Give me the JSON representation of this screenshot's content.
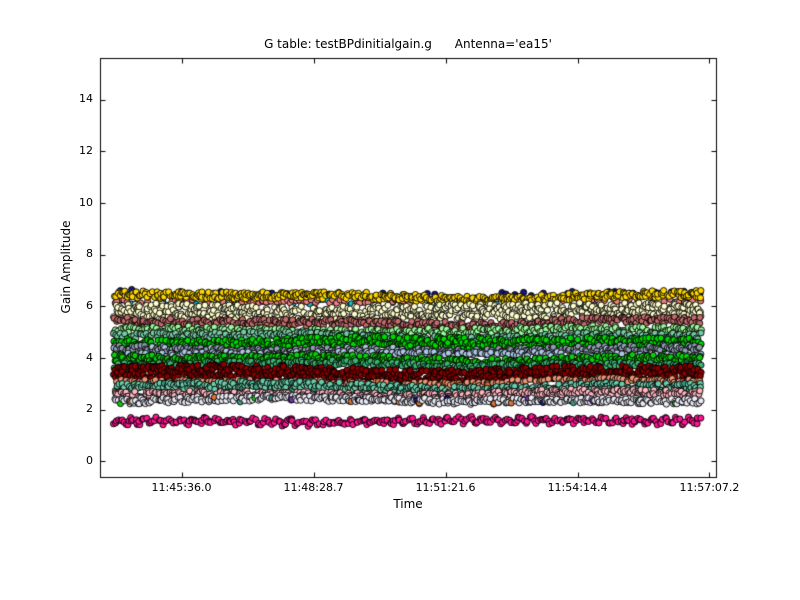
{
  "figure": {
    "background": "#FFFFFF",
    "frame_color": "#000000"
  },
  "chart_data": {
    "type": "scatter",
    "title": "G table: testBPdinitialgain.g      Antenna='ea15'",
    "xlabel": "Time",
    "ylabel": "Gain Amplitude",
    "xticklabels": [
      "11:45:36.0",
      "11:48:28.7",
      "11:51:21.6",
      "11:54:14.4",
      "11:57:07.2"
    ],
    "xtick_positions": [
      0.1315,
      0.3458,
      0.5601,
      0.7744,
      0.9886
    ],
    "yticklabels": [
      "0",
      "2",
      "4",
      "6",
      "8",
      "10",
      "12",
      "14"
    ],
    "yticks": [
      0,
      2,
      4,
      6,
      8,
      10,
      12,
      14
    ],
    "ylim": [
      -0.62,
      15.6
    ],
    "grid": false,
    "legend": "none",
    "marker": {
      "radius": 3.1,
      "edge_color": "#000000",
      "edge_width": 0.9
    },
    "data_x_span": [
      0.0227,
      0.9756
    ],
    "series": [
      {
        "name": "navy-speckles",
        "color": "#161685",
        "center": 6.5,
        "spread": 0.1,
        "density": 0.13,
        "wave": 0.05
      },
      {
        "name": "cyan-speckles",
        "color": "#00CBDB",
        "center": 6.17,
        "spread": 0.13,
        "density": 0.13,
        "wave": 0.05
      },
      {
        "name": "lightcoral-row",
        "color": "#F08080",
        "center": 6.23,
        "spread": 0.08,
        "density": 0.4,
        "wave": 0.05
      },
      {
        "name": "gold-band",
        "color": "#FFD700",
        "center": 6.4,
        "spread": 0.14,
        "density": 1.7,
        "wave": 0.07
      },
      {
        "name": "cream-band",
        "color": "#FFFFCC",
        "center": 5.78,
        "spread": 0.32,
        "density": 2.6,
        "wave": 0.06
      },
      {
        "name": "rosybrown-band",
        "color": "#C36B6B",
        "center": 5.38,
        "spread": 0.14,
        "density": 1.3,
        "wave": 0.06
      },
      {
        "name": "palegreen-band",
        "color": "#98FB98",
        "center": 5.08,
        "spread": 0.13,
        "density": 1.2,
        "wave": 0.05
      },
      {
        "name": "seafoam-band",
        "color": "#76C9A5",
        "center": 4.85,
        "spread": 0.12,
        "density": 1.0,
        "wave": 0.05
      },
      {
        "name": "green-band",
        "color": "#00D800",
        "center": 4.57,
        "spread": 0.22,
        "density": 2.2,
        "wave": 0.06
      },
      {
        "name": "slategray-band",
        "color": "#8E9EAE",
        "center": 4.32,
        "spread": 0.12,
        "density": 1.1,
        "wave": 0.05,
        "speckles": [
          "#B0C4DE"
        ],
        "speckle_prob": 0.1
      },
      {
        "name": "steelblue-band",
        "color": "#AEC6E4",
        "center": 4.15,
        "spread": 0.1,
        "density": 0.7,
        "wave": 0.05
      },
      {
        "name": "green2-band",
        "color": "#0BCE0B",
        "center": 3.97,
        "spread": 0.13,
        "density": 1.4,
        "wave": 0.05
      },
      {
        "name": "medseagreen-band",
        "color": "#3CB371",
        "center": 3.75,
        "spread": 0.11,
        "density": 1.0,
        "wave": 0.05
      },
      {
        "name": "darkred-band",
        "color": "#8B0000",
        "center": 3.42,
        "spread": 0.26,
        "density": 2.5,
        "wave": 0.07
      },
      {
        "name": "darksalmon-band",
        "color": "#EB9676",
        "center": 3.08,
        "spread": 0.09,
        "density": 0.8,
        "wave": 0.05,
        "speckles": [
          "#E07030"
        ],
        "speckle_prob": 0.06
      },
      {
        "name": "aquamarine-band",
        "color": "#69CDA9",
        "center": 2.88,
        "spread": 0.15,
        "density": 1.5,
        "wave": 0.06,
        "speckles": [
          "#379E86"
        ],
        "speckle_prob": 0.08
      },
      {
        "name": "pink-band",
        "color": "#FFB6C1",
        "center": 2.61,
        "spread": 0.12,
        "density": 1.4,
        "wave": 0.05
      },
      {
        "name": "lavender-band",
        "color": "#EAEAF6",
        "center": 2.38,
        "spread": 0.11,
        "density": 1.3,
        "wave": 0.05,
        "speckles": [
          "#161685",
          "#7B2FBE",
          "#0BCE0B",
          "#E07030",
          "#379E86"
        ],
        "speckle_prob": 0.12
      },
      {
        "name": "deeppink-band",
        "color": "#FF1493",
        "center": 1.57,
        "spread": 0.08,
        "density": 1.2,
        "wave": 0.04,
        "wiggle": 0.08
      }
    ]
  }
}
